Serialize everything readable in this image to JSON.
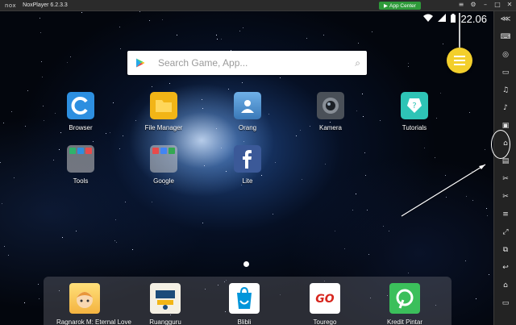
{
  "window": {
    "logo": "nox",
    "title": "NoxPlayer 6.2.3.3",
    "app_center_label": "App Center",
    "app_center_color": "#2e9a3a",
    "controls": [
      "menu-icon",
      "settings-icon",
      "minimize-icon",
      "maximize-icon",
      "close-icon"
    ]
  },
  "status": {
    "time": "22.06",
    "icons": [
      "wifi-icon",
      "signal-icon",
      "battery-icon"
    ]
  },
  "search": {
    "placeholder": "Search Game, App...",
    "icon_left": "play-store-icon",
    "icon_right": "search-icon"
  },
  "fab": {
    "color": "#f3cf2c",
    "icon": "list-icon"
  },
  "apps": [
    {
      "label": "Browser",
      "icon": "browser-icon",
      "color": "#2d8fe0"
    },
    {
      "label": "File Manager",
      "icon": "folder-icon",
      "color": "#f2b516"
    },
    {
      "label": "Orang",
      "icon": "contacts-icon",
      "color": "#3a79b8"
    },
    {
      "label": "Kamera",
      "icon": "camera-icon",
      "color": "#4a5058"
    },
    {
      "label": "Tutorials",
      "icon": "tutorials-icon",
      "color": "#2ec4b6"
    },
    {
      "label": "Tools",
      "icon": "folder-icon",
      "color": "#c8c8c8"
    },
    {
      "label": "Google",
      "icon": "folder-icon",
      "color": "#c8c8c8"
    },
    {
      "label": "Lite",
      "icon": "facebook-icon",
      "color": "#3b5998"
    }
  ],
  "dock": [
    {
      "label": "Ragnarok M: Eternal Love",
      "icon": "ragnarok-icon",
      "color": "#f4b340"
    },
    {
      "label": "Ruangguru",
      "icon": "ruangguru-icon",
      "color": "#1c4c7a"
    },
    {
      "label": "Blibli",
      "icon": "blibli-icon",
      "color": "#ffffff"
    },
    {
      "label": "Tourego",
      "icon": "tourego-icon",
      "color": "#ffffff"
    },
    {
      "label": "Kredit Pintar",
      "icon": "kredit-pintar-icon",
      "color": "#3bbf5b"
    }
  ],
  "sidebar": {
    "items": [
      "toolbar-toggle-icon",
      "keyboard-icon",
      "location-icon",
      "screen-icon",
      "volume-up-icon",
      "volume-down-icon",
      "screenshot-icon",
      "shake-icon",
      "toolbox-icon",
      "scissors-icon",
      "record-icon",
      "menu-icon",
      "resize-icon",
      "multi-instance-icon",
      "back-icon",
      "home-icon",
      "recent-apps-icon"
    ]
  }
}
